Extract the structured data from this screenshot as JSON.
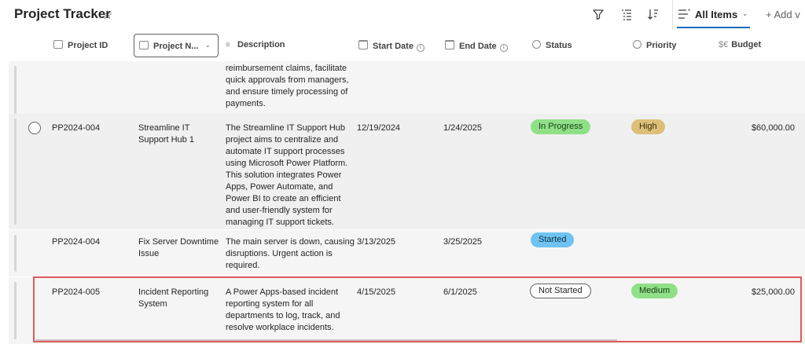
{
  "app": {
    "title": "Project Tracker",
    "view_label": "All Items",
    "add_view_label": "+ Add v"
  },
  "columns": {
    "project_id": "Project ID",
    "project_name": "Project N...",
    "description": "Description",
    "start_date": "Start Date",
    "end_date": "End Date",
    "status": "Status",
    "priority": "Priority",
    "budget": "Budget"
  },
  "rows": [
    {
      "project_id": "",
      "project_name": "",
      "description_lines": [
        "reimbursement claims, facilitate",
        "quick approvals from managers,",
        "and ensure timely processing of",
        "payments."
      ],
      "start_date": "",
      "end_date": "",
      "status": "",
      "priority": "",
      "budget": ""
    },
    {
      "project_id": "PP2024-004",
      "project_name_lines": [
        "Streamline IT",
        "Support Hub 1"
      ],
      "description_lines": [
        "The Streamline IT Support Hub",
        "project aims to centralize and",
        "automate IT support processes",
        "using Microsoft Power Platform.",
        "This solution integrates Power",
        "Apps, Power Automate, and",
        "Power BI to create an efficient",
        "and user-friendly system for",
        "managing IT support tickets."
      ],
      "start_date": "12/19/2024",
      "end_date": "1/24/2025",
      "status": "In Progress",
      "priority": "High",
      "budget": "$60,000.00"
    },
    {
      "project_id": "PP2024-004",
      "project_name_lines": [
        "Fix Server Downtime",
        "Issue"
      ],
      "description_lines": [
        "The main server is down, causing",
        "disruptions. Urgent action is",
        "required."
      ],
      "start_date": "3/13/2025",
      "end_date": "3/25/2025",
      "status": "Started",
      "priority": "",
      "budget": ""
    },
    {
      "project_id": "PP2024-005",
      "project_name_lines": [
        "Incident Reporting",
        "System"
      ],
      "description_lines": [
        "A Power Apps-based incident",
        "reporting system for all",
        "departments to log, track, and",
        "resolve workplace incidents."
      ],
      "start_date": "4/15/2025",
      "end_date": "6/1/2025",
      "status": "Not Started",
      "priority": "Medium",
      "budget": "$25,000.00"
    }
  ],
  "colors": {
    "status_in_progress": "#8fe086",
    "status_started": "#6fc2f1",
    "priority_high": "#dcc079",
    "priority_medium": "#8fe086",
    "highlight_border": "#e05a5a",
    "accent": "#0f6cbd"
  },
  "icons": {
    "favorite": "star-icon",
    "filter": "filter-icon",
    "group": "group-icon",
    "sort": "sort-icon",
    "view": "view-lines-icon"
  }
}
